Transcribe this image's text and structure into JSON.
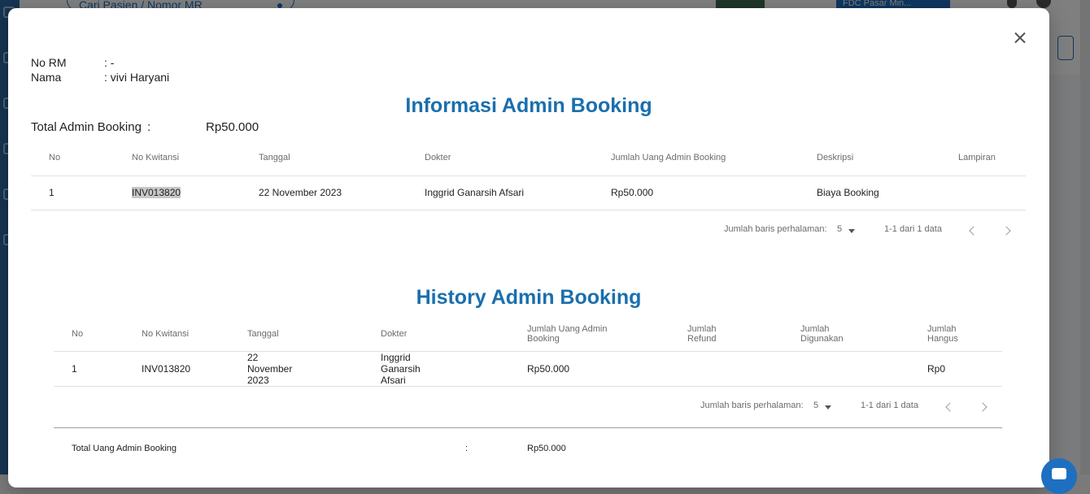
{
  "background": {
    "search_placeholder": "Cari Pasien / Nomor MR",
    "clinic_name": "FDC Pasar Min..."
  },
  "patient": {
    "rm_label": "No RM",
    "rm_value": ": -",
    "name_label": "Nama",
    "name_value": ": vivi Haryani"
  },
  "info": {
    "title": "Informasi Admin Booking",
    "total_label": "Total Admin Booking",
    "total_colon": ":",
    "total_value": "Rp50.000",
    "columns": [
      "No",
      "No Kwitansi",
      "Tanggal",
      "Dokter",
      "Jumlah Uang Admin Booking",
      "Deskripsi",
      "Lampiran"
    ],
    "rows": [
      {
        "no": "1",
        "kwitansi": "INV013820",
        "tanggal": "22 November 2023",
        "dokter": "Inggrid Ganarsih Afsari",
        "jumlah": "Rp50.000",
        "deskripsi": "Biaya Booking",
        "lampiran": ""
      }
    ],
    "pager": {
      "rows_label": "Jumlah baris perhalaman:",
      "rows_value": "5",
      "range": "1-1 dari 1 data"
    }
  },
  "history": {
    "title": "History Admin Booking",
    "columns": [
      "No",
      "No Kwitansi",
      "Tanggal",
      "Dokter",
      "Jumlah Uang Admin Booking",
      "Jumlah Refund",
      "Jumlah Digunakan",
      "Jumlah Hangus"
    ],
    "rows": [
      {
        "no": "1",
        "kwitansi": "INV013820",
        "tanggal": "22 November 2023",
        "dokter": "Inggrid Ganarsih Afsari",
        "jumlah": "Rp50.000",
        "refund": "",
        "digunakan": "",
        "hangus": "Rp0"
      }
    ],
    "pager": {
      "rows_label": "Jumlah baris perhalaman:",
      "rows_value": "5",
      "range": "1-1 dari 1 data"
    },
    "summary_label": "Total Uang Admin Booking",
    "summary_colon": ":",
    "summary_value": "Rp50.000"
  },
  "colors": {
    "accent": "#1a6fad",
    "brand": "#1e6fc0"
  }
}
